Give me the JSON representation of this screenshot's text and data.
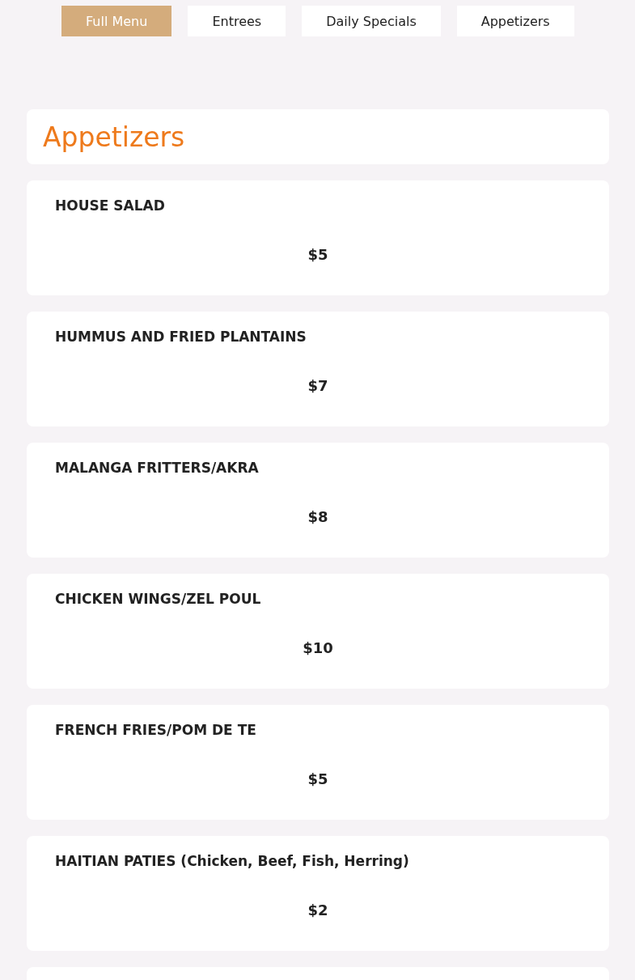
{
  "tabs": [
    {
      "label": "Full Menu",
      "selected": true
    },
    {
      "label": "Entrees",
      "selected": false
    },
    {
      "label": "Daily Specials",
      "selected": false
    },
    {
      "label": "Appetizers",
      "selected": false
    }
  ],
  "section": {
    "title": "Appetizers"
  },
  "items": [
    {
      "name": "HOUSE SALAD",
      "price": "$5"
    },
    {
      "name": "HUMMUS AND FRIED PLANTAINS",
      "price": "$7"
    },
    {
      "name": "MALANGA FRITTERS/AKRA",
      "price": "$8"
    },
    {
      "name": "CHICKEN WINGS/ZEL POUL",
      "price": "$10"
    },
    {
      "name": "FRENCH FRIES/POM DE TE",
      "price": "$5"
    },
    {
      "name": "HAITIAN PATIES (Chicken, Beef, Fish, Herring)",
      "price": "$2"
    }
  ]
}
